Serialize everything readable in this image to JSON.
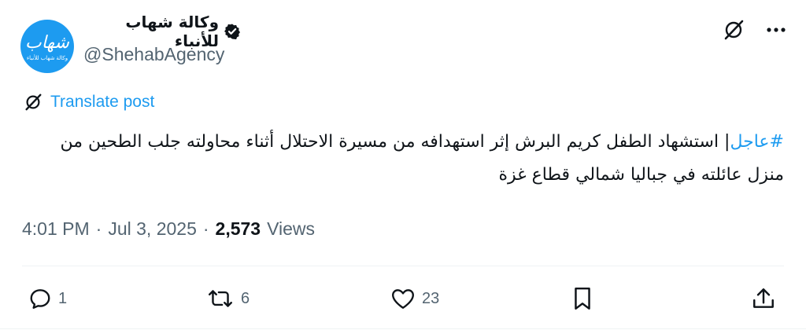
{
  "account": {
    "display_name": "وكالة شهاب للأنباء",
    "handle": "@ShehabAgency",
    "avatar_logo_text": "شهاب",
    "avatar_sub_text": "وكالة شهاب للأنباء",
    "verified_icon": "verified-badge-icon"
  },
  "top_actions": {
    "grok_icon": "grok-icon",
    "more_icon": "more-icon"
  },
  "translate": {
    "label": "Translate post",
    "icon": "grok-icon"
  },
  "post": {
    "hashtag": "#عاجل",
    "body": "| استشهاد الطفل كريم البرش إثر استهدافه من مسيرة الاحتلال أثناء محاولته جلب الطحين من منزل عائلته في جباليا شمالي قطاع غزة"
  },
  "meta": {
    "time": "4:01 PM",
    "separator1": "·",
    "date": "Jul 3, 2025",
    "separator2": "·",
    "views_count": "2,573",
    "views_label": "Views"
  },
  "actions": {
    "reply_count": "1",
    "repost_count": "6",
    "like_count": "23"
  },
  "colors": {
    "accent": "#1d9bf0",
    "muted": "#536471",
    "text": "#0f1419"
  }
}
